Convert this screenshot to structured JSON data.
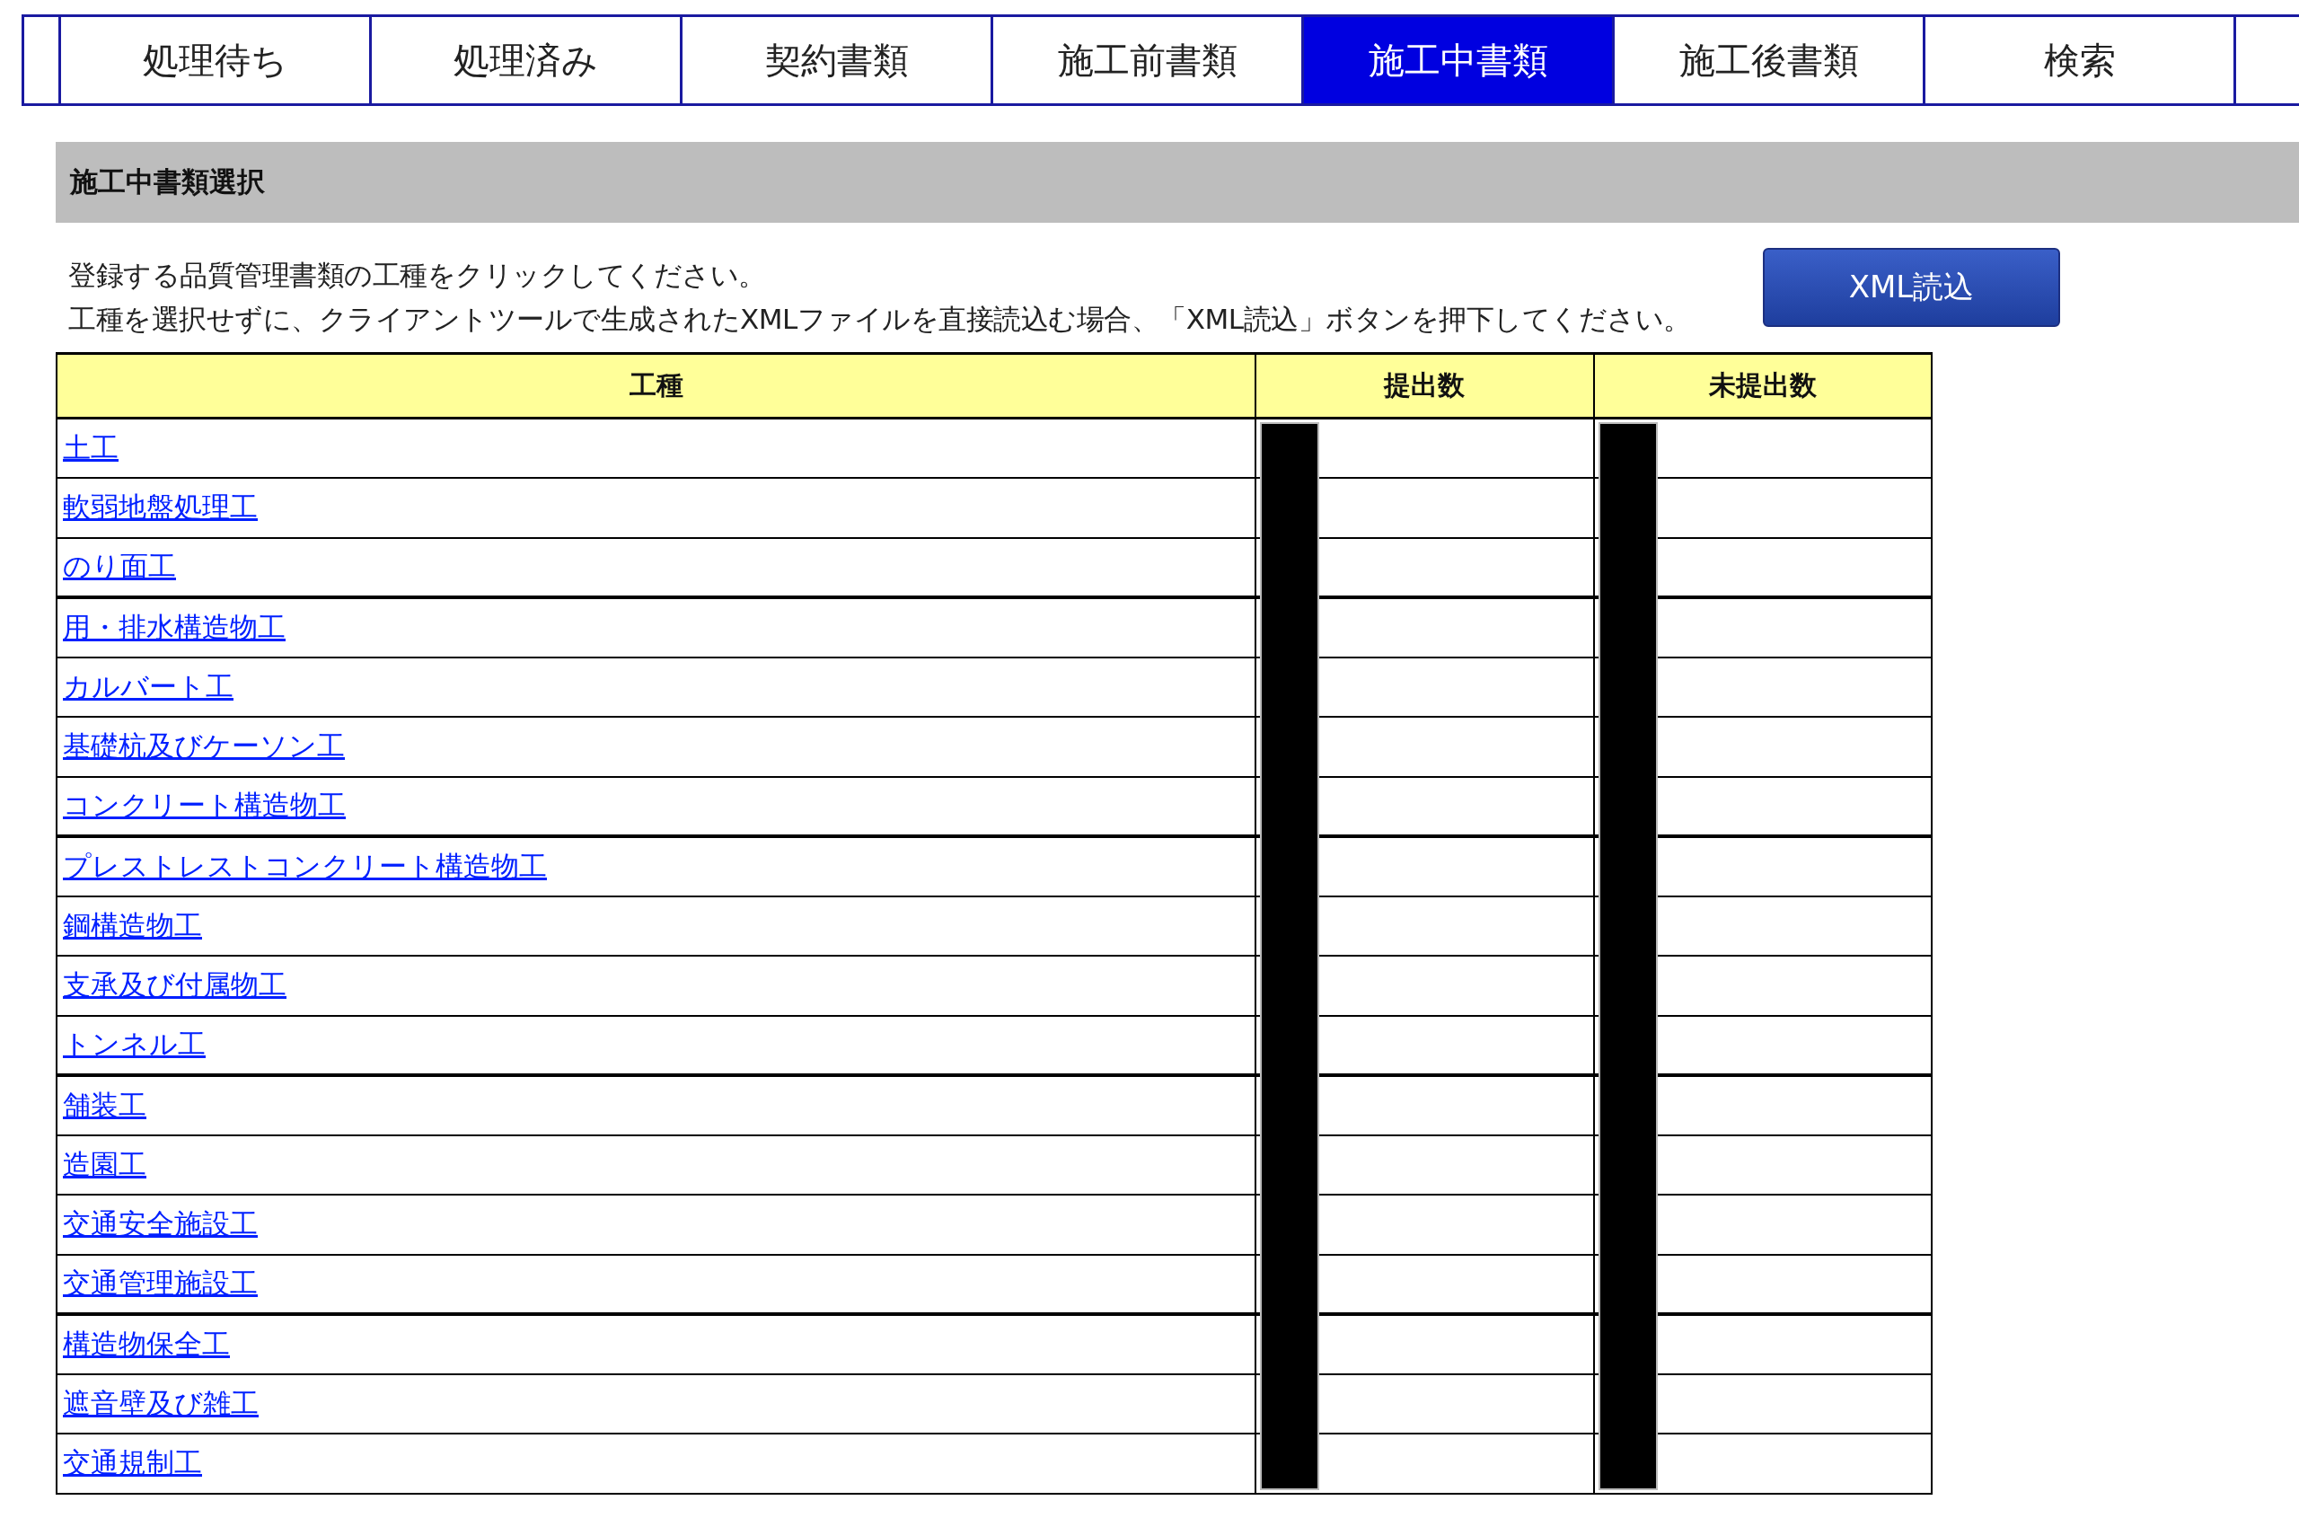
{
  "tabs": [
    {
      "label": "処理待ち",
      "selected": false
    },
    {
      "label": "処理済み",
      "selected": false
    },
    {
      "label": "契約書類",
      "selected": false
    },
    {
      "label": "施工前書類",
      "selected": false
    },
    {
      "label": "施工中書類",
      "selected": true
    },
    {
      "label": "施工後書類",
      "selected": false
    },
    {
      "label": "検索",
      "selected": false
    }
  ],
  "section": {
    "title": "施工中書類選択"
  },
  "instructions": [
    "登録する品質管理書類の工種をクリックしてください。",
    "工種を選択せずに、クライアントツールで生成されたXMLファイルを直接読込む場合、「XML読込」ボタンを押下してください。"
  ],
  "xml_button": "XML読込",
  "table": {
    "columns": [
      {
        "label": "工種"
      },
      {
        "label": "提出数"
      },
      {
        "label": "未提出数"
      }
    ],
    "rows": [
      {
        "name": "土工"
      },
      {
        "name": "軟弱地盤処理工"
      },
      {
        "name": "のり面工"
      },
      {
        "name": "用・排水構造物工"
      },
      {
        "name": "カルバート工"
      },
      {
        "name": "基礎杭及びケーソン工"
      },
      {
        "name": "コンクリート構造物工"
      },
      {
        "name": "プレストレストコンクリート構造物工"
      },
      {
        "name": "鋼構造物工"
      },
      {
        "name": "支承及び付属物工"
      },
      {
        "name": "トンネル工"
      },
      {
        "name": "舗装工"
      },
      {
        "name": "造園工"
      },
      {
        "name": "交通安全施設工"
      },
      {
        "name": "交通管理施設工"
      },
      {
        "name": "構造物保全工"
      },
      {
        "name": "遮音壁及び雑工"
      },
      {
        "name": "交通規制工"
      }
    ]
  }
}
